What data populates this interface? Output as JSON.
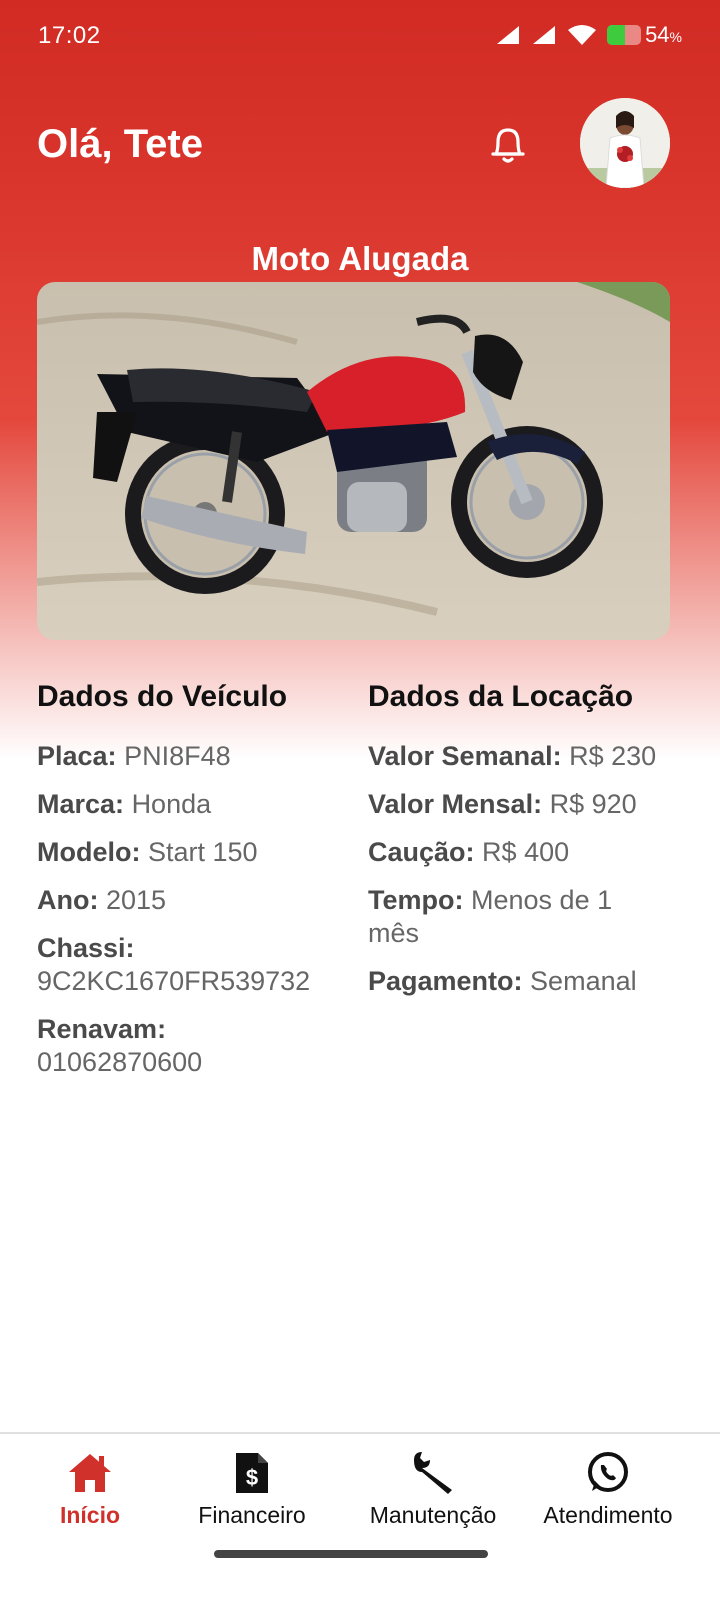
{
  "status_bar": {
    "time": "17:02",
    "battery_percent": "54",
    "battery_unit": "%",
    "battery_level": 0.54
  },
  "header": {
    "greeting": "Olá, Tete",
    "notification_icon": "bell-icon",
    "avatar_icon": "user-avatar"
  },
  "rented": {
    "title": "Moto Alugada"
  },
  "vehicle": {
    "heading": "Dados do Veículo",
    "fields": [
      {
        "label": "Placa:",
        "value": "PNI8F48"
      },
      {
        "label": "Marca:",
        "value": "Honda"
      },
      {
        "label": "Modelo:",
        "value": "Start 150"
      },
      {
        "label": "Ano:",
        "value": "2015"
      },
      {
        "label": "Chassi:",
        "value": "9C2KC1670FR539732"
      },
      {
        "label": "Renavam:",
        "value": "01062870600"
      }
    ]
  },
  "rental": {
    "heading": "Dados da Locação",
    "fields": [
      {
        "label": "Valor Semanal:",
        "value": "R$ 230"
      },
      {
        "label": "Valor Mensal:",
        "value": "R$ 920"
      },
      {
        "label": "Caução:",
        "value": "R$ 400"
      },
      {
        "label": "Tempo:",
        "value": "Menos de 1 mês"
      },
      {
        "label": "Pagamento:",
        "value": "Semanal"
      }
    ]
  },
  "nav": [
    {
      "label": "Início",
      "icon": "home-icon",
      "active": true
    },
    {
      "label": "Financeiro",
      "icon": "invoice-dollar-icon",
      "active": false
    },
    {
      "label": "Manutenção",
      "icon": "wrench-icon",
      "active": false
    },
    {
      "label": "Atendimento",
      "icon": "whatsapp-icon",
      "active": false
    }
  ],
  "colors": {
    "primary": "#d12b24",
    "active_nav": "#d0322b"
  }
}
